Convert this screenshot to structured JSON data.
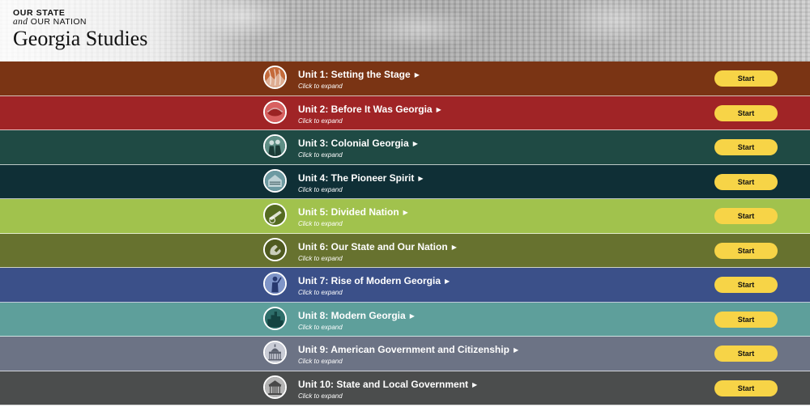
{
  "header": {
    "brand_line1": "OUR STATE",
    "brand_line2_prefix": "and",
    "brand_line2_suffix": " OUR NATION",
    "title": "Georgia Studies"
  },
  "units": [
    {
      "title": "Unit 1: Setting the Stage",
      "subtitle": "Click to expand",
      "start": "Start",
      "color": "#7a3414",
      "icon": "landscape-icon",
      "icon_color": "#c46a3a"
    },
    {
      "title": "Unit 2: Before It Was Georgia",
      "subtitle": "Click to expand",
      "start": "Start",
      "color": "#a02426",
      "icon": "artifact-icon",
      "icon_color": "#d86060"
    },
    {
      "title": "Unit 3: Colonial Georgia",
      "subtitle": "Click to expand",
      "start": "Start",
      "color": "#1f4a44",
      "icon": "colonists-icon",
      "icon_color": "#5f8f86"
    },
    {
      "title": "Unit 4: The Pioneer Spirit",
      "subtitle": "Click to expand",
      "start": "Start",
      "color": "#0f2f36",
      "icon": "cabin-icon",
      "icon_color": "#6c9aa2"
    },
    {
      "title": "Unit 5: Divided Nation",
      "subtitle": "Click to expand",
      "start": "Start",
      "color": "#a1c24d",
      "icon": "cannon-icon",
      "icon_color": "#556b22"
    },
    {
      "title": "Unit 6: Our State and Our Nation",
      "subtitle": "Click to expand",
      "start": "Start",
      "color": "#67722f",
      "icon": "telephone-icon",
      "icon_color": "#4f5a20"
    },
    {
      "title": "Unit 7: Rise of Modern Georgia",
      "subtitle": "Click to expand",
      "start": "Start",
      "color": "#3b5089",
      "icon": "statue-icon",
      "icon_color": "#7f95c8"
    },
    {
      "title": "Unit 8: Modern Georgia",
      "subtitle": "Click to expand",
      "start": "Start",
      "color": "#5e9f9b",
      "icon": "skyline-icon",
      "icon_color": "#2e6e6a"
    },
    {
      "title": "Unit 9: American Government and Citizenship",
      "subtitle": "Click to expand",
      "start": "Start",
      "color": "#6c7385",
      "icon": "capitol-icon",
      "icon_color": "#c9ccd6"
    },
    {
      "title": "Unit 10: State and Local Government",
      "subtitle": "Click to expand",
      "start": "Start",
      "color": "#4b4d4d",
      "icon": "courthouse-icon",
      "icon_color": "#b5b5b5"
    }
  ]
}
